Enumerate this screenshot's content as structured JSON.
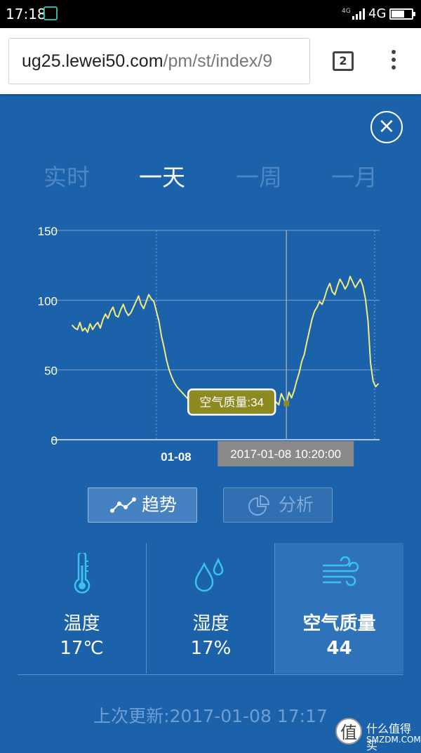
{
  "status_bar": {
    "time": "17:18",
    "network_small": "4G",
    "network": "4G"
  },
  "browser": {
    "url_host": "ug25.lewei50.com",
    "url_path": "/pm/st/index/9",
    "tab_count": "2"
  },
  "close_icon": "×",
  "tabs": [
    {
      "label": "实时",
      "active": false
    },
    {
      "label": "一天",
      "active": true
    },
    {
      "label": "一周",
      "active": false
    },
    {
      "label": "一月",
      "active": false
    }
  ],
  "chart_data": {
    "type": "line",
    "y_ticks": [
      "0",
      "50",
      "100",
      "150"
    ],
    "ylim": [
      0,
      150
    ],
    "x_tick_label": "01-08",
    "tooltip": "空气质量:34",
    "crosshair_time": "2017-01-08 10:20:00",
    "colors": {
      "line": "#f2ea7d",
      "tooltip_bg": "#8c8a20",
      "crosshair_label_bg": "#8a8a8a"
    },
    "series": [
      {
        "values": [
          82,
          80,
          79,
          84,
          78,
          80,
          77,
          83,
          79,
          82,
          84,
          80,
          86,
          90,
          87,
          92,
          95,
          89,
          88,
          93,
          97,
          92,
          89,
          91,
          95,
          99,
          103,
          97,
          94,
          99,
          104,
          101,
          99,
          92,
          85,
          74,
          66,
          57,
          50,
          45,
          41,
          38,
          36,
          34,
          32,
          30,
          28,
          31,
          27,
          25,
          27,
          30,
          24,
          26,
          29,
          28,
          24,
          26,
          30,
          29,
          23,
          25,
          28,
          26,
          24,
          27,
          29,
          26,
          24,
          26,
          23,
          25,
          27,
          30,
          26,
          22,
          25,
          28,
          26,
          24,
          27,
          25,
          33,
          29,
          26,
          34,
          30,
          35,
          42,
          48,
          56,
          61,
          70,
          78,
          86,
          92,
          95,
          99,
          97,
          102,
          108,
          112,
          106,
          104,
          110,
          115,
          112,
          108,
          111,
          117,
          113,
          109,
          112,
          115,
          110,
          101,
          85,
          55,
          42,
          38,
          40
        ]
      }
    ],
    "x_range": [
      "2017-01-07 17:20",
      "2017-01-08 17:20"
    ],
    "crosshair_index": 84,
    "x_tick_index": 33,
    "grid": true
  },
  "buttons": {
    "trend": "趋势",
    "analysis": "分析"
  },
  "cards": [
    {
      "label": "温度",
      "value": "17℃",
      "icon": "thermometer-icon"
    },
    {
      "label": "湿度",
      "value": "17%",
      "icon": "water-drops-icon"
    },
    {
      "label": "空气质量",
      "value": "44",
      "icon": "wind-icon"
    }
  ],
  "updated": {
    "label": "上次更新:",
    "time": "2017-01-08 17:17"
  },
  "watermark": {
    "logo": "值",
    "text1": "什么值得买",
    "text2": "SMZDM.COM"
  }
}
